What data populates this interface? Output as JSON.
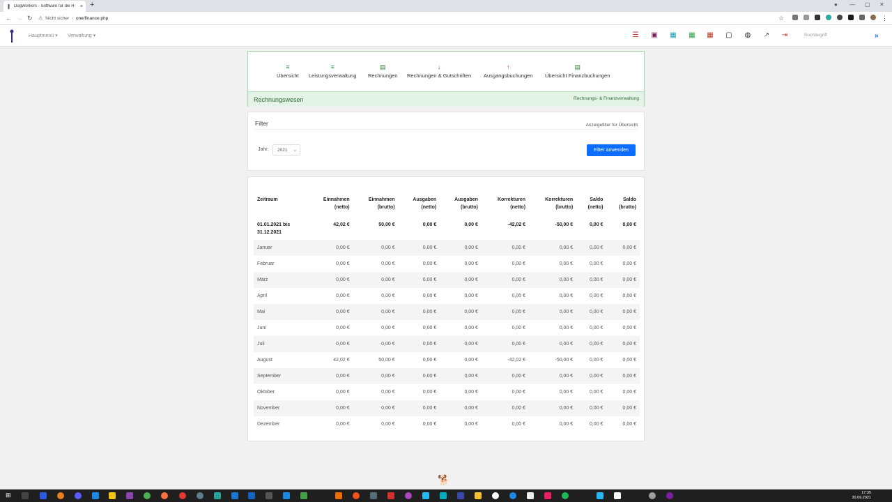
{
  "browser": {
    "tab_title": "DogWorkers - Software für die H",
    "tab_close": "×",
    "new_tab": "+",
    "url_warning": "Nicht sicher",
    "url_path": "one/finance.php",
    "controls": [
      "—",
      "▢",
      "✕"
    ]
  },
  "header": {
    "menu_main": "Hauptmenü ▾",
    "menu_admin": "Verwaltung ▾",
    "search_placeholder": "Suchbegriff",
    "chevron": "»"
  },
  "nav": {
    "items": [
      {
        "icon": "≡",
        "label": "Übersicht"
      },
      {
        "icon": "≡",
        "label": "Leistungsverwaltung"
      },
      {
        "icon": "▤",
        "label": "Rechnungen"
      },
      {
        "icon": "↓",
        "label": "Rechnungen & Gutschriften"
      },
      {
        "icon": "↑",
        "label": "Ausgangsbuchungen"
      },
      {
        "icon": "▤",
        "label": "Übersicht Finanzbuchungen"
      }
    ],
    "section_title": "Rechnungswesen",
    "section_sub": "Rechnungs- & Finanzverwaltung"
  },
  "filter": {
    "title": "Filter",
    "subtitle": "Anzeigefilter für Übersicht",
    "year_label": "Jahr:",
    "year_value": "2021",
    "apply_button": "Filter anwenden"
  },
  "table": {
    "headers": [
      [
        "Zeitraum",
        ""
      ],
      [
        "Einnahmen",
        "(netto)"
      ],
      [
        "Einnahmen",
        "(brutto)"
      ],
      [
        "Ausgaben",
        "(netto)"
      ],
      [
        "Ausgaben",
        "(brutto)"
      ],
      [
        "Korrekturen",
        "(netto)"
      ],
      [
        "Korrekturen",
        "(brutto)"
      ],
      [
        "Saldo",
        "(netto)"
      ],
      [
        "Saldo",
        "(brutto)"
      ]
    ],
    "summary": [
      "01.01.2021 bis",
      "31.12.2021",
      "42,02 €",
      "50,00 €",
      "0,00 €",
      "0,00 €",
      "-42,02 €",
      "-50,00 €",
      "0,00 €",
      "0,00 €"
    ],
    "rows": [
      [
        "Januar",
        "0,00 €",
        "0,00 €",
        "0,00 €",
        "0,00 €",
        "0,00 €",
        "0,00 €",
        "0,00 €",
        "0,00 €"
      ],
      [
        "Februar",
        "0,00 €",
        "0,00 €",
        "0,00 €",
        "0,00 €",
        "0,00 €",
        "0,00 €",
        "0,00 €",
        "0,00 €"
      ],
      [
        "März",
        "0,00 €",
        "0,00 €",
        "0,00 €",
        "0,00 €",
        "0,00 €",
        "0,00 €",
        "0,00 €",
        "0,00 €"
      ],
      [
        "April",
        "0,00 €",
        "0,00 €",
        "0,00 €",
        "0,00 €",
        "0,00 €",
        "0,00 €",
        "0,00 €",
        "0,00 €"
      ],
      [
        "Mai",
        "0,00 €",
        "0,00 €",
        "0,00 €",
        "0,00 €",
        "0,00 €",
        "0,00 €",
        "0,00 €",
        "0,00 €"
      ],
      [
        "Juni",
        "0,00 €",
        "0,00 €",
        "0,00 €",
        "0,00 €",
        "0,00 €",
        "0,00 €",
        "0,00 €",
        "0,00 €"
      ],
      [
        "Juli",
        "0,00 €",
        "0,00 €",
        "0,00 €",
        "0,00 €",
        "0,00 €",
        "0,00 €",
        "0,00 €",
        "0,00 €"
      ],
      [
        "August",
        "42,02 €",
        "50,00 €",
        "0,00 €",
        "0,00 €",
        "-42,02 €",
        "-50,00 €",
        "0,00 €",
        "0,00 €"
      ],
      [
        "September",
        "0,00 €",
        "0,00 €",
        "0,00 €",
        "0,00 €",
        "0,00 €",
        "0,00 €",
        "0,00 €",
        "0,00 €"
      ],
      [
        "Oktober",
        "0,00 €",
        "0,00 €",
        "0,00 €",
        "0,00 €",
        "0,00 €",
        "0,00 €",
        "0,00 €",
        "0,00 €"
      ],
      [
        "November",
        "0,00 €",
        "0,00 €",
        "0,00 €",
        "0,00 €",
        "0,00 €",
        "0,00 €",
        "0,00 €",
        "0,00 €"
      ],
      [
        "Dezember",
        "0,00 €",
        "0,00 €",
        "0,00 €",
        "0,00 €",
        "0,00 €",
        "0,00 €",
        "0,00 €",
        "0,00 €"
      ]
    ]
  },
  "taskbar": {
    "time": "17:35",
    "date": "30.09.2021"
  },
  "colors": {
    "accent": "#0d6efd",
    "nav_green": "#2e6b34",
    "nav_bg": "#e3f3e5"
  }
}
